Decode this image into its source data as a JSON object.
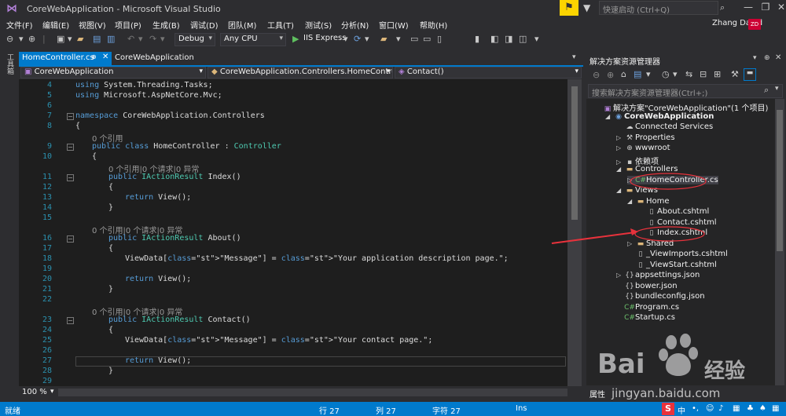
{
  "title": {
    "app": "CoreWebApplication - Microsoft Visual Studio",
    "quick_launch": "快速启动 (Ctrl+Q)"
  },
  "menu": {
    "items": [
      "文件(F)",
      "编辑(E)",
      "视图(V)",
      "项目(P)",
      "生成(B)",
      "调试(D)",
      "团队(M)",
      "工具(T)",
      "测试(S)",
      "分析(N)",
      "窗口(W)",
      "帮助(H)"
    ],
    "user": "Zhang David",
    "avatar": "ZD"
  },
  "toolbar": {
    "config": "Debug",
    "platform": "Any CPU",
    "run": "IIS Express"
  },
  "leftstrip": {
    "label": "工具箱"
  },
  "tabs": {
    "active": "HomeController.cs",
    "other": "CoreWebApplication"
  },
  "navbar": {
    "project": "CoreWebApplication",
    "class": "CoreWebApplication.Controllers.HomeControl",
    "member": "Contact()"
  },
  "code": {
    "lines": [
      {
        "n": "4",
        "t": "using System.Threading.Tasks;"
      },
      {
        "n": "5",
        "t": "using Microsoft.AspNetCore.Mvc;"
      },
      {
        "n": "6",
        "t": ""
      },
      {
        "n": "7",
        "t": "namespace CoreWebApplication.Controllers"
      },
      {
        "n": "8",
        "t": "{"
      },
      {
        "n": "",
        "t": "0 个引用"
      },
      {
        "n": "9",
        "t": "public class HomeController : Controller"
      },
      {
        "n": "10",
        "t": "{"
      },
      {
        "n": "",
        "t": "0 个引用|0 个请求|0 异常"
      },
      {
        "n": "11",
        "t": "public IActionResult Index()"
      },
      {
        "n": "12",
        "t": "{"
      },
      {
        "n": "13",
        "t": "return View();"
      },
      {
        "n": "14",
        "t": "}"
      },
      {
        "n": "15",
        "t": ""
      },
      {
        "n": "",
        "t": "0 个引用|0 个请求|0 异常"
      },
      {
        "n": "16",
        "t": "public IActionResult About()"
      },
      {
        "n": "17",
        "t": "{"
      },
      {
        "n": "18",
        "t": "ViewData[\"Message\"] = \"Your application description page.\";"
      },
      {
        "n": "19",
        "t": ""
      },
      {
        "n": "20",
        "t": "return View();"
      },
      {
        "n": "21",
        "t": "}"
      },
      {
        "n": "22",
        "t": ""
      },
      {
        "n": "",
        "t": "0 个引用|0 个请求|0 异常"
      },
      {
        "n": "23",
        "t": "public IActionResult Contact()"
      },
      {
        "n": "24",
        "t": "{"
      },
      {
        "n": "25",
        "t": "ViewData[\"Message\"] = \"Your contact page.\";"
      },
      {
        "n": "26",
        "t": ""
      },
      {
        "n": "27",
        "t": "return View();"
      },
      {
        "n": "28",
        "t": "}"
      },
      {
        "n": "29",
        "t": ""
      }
    ]
  },
  "zoom": "100 %",
  "solution": {
    "header": "解决方案资源管理器",
    "search_placeholder": "搜索解决方案资源管理器(Ctrl+;)",
    "items": [
      {
        "label": "解决方案\"CoreWebApplication\"(1 个项目)",
        "icon": "solution-icon"
      },
      {
        "label": "CoreWebApplication",
        "icon": "project-icon"
      },
      {
        "label": "Connected Services",
        "icon": "connected-services-icon"
      },
      {
        "label": "Properties",
        "icon": "wrench-icon"
      },
      {
        "label": "wwwroot",
        "icon": "globe-icon"
      },
      {
        "label": "依赖项",
        "icon": "dependencies-icon"
      },
      {
        "label": "Controllers",
        "icon": "folder-icon"
      },
      {
        "label": "HomeController.cs",
        "icon": "csharp-file-icon"
      },
      {
        "label": "Views",
        "icon": "folder-icon"
      },
      {
        "label": "Home",
        "icon": "folder-icon"
      },
      {
        "label": "About.cshtml",
        "icon": "file-icon"
      },
      {
        "label": "Contact.cshtml",
        "icon": "file-icon"
      },
      {
        "label": "Index.cshtml",
        "icon": "file-icon"
      },
      {
        "label": "Shared",
        "icon": "folder-icon"
      },
      {
        "label": "_ViewImports.cshtml",
        "icon": "file-icon"
      },
      {
        "label": "_ViewStart.cshtml",
        "icon": "file-icon"
      },
      {
        "label": "appsettings.json",
        "icon": "json-icon"
      },
      {
        "label": "bower.json",
        "icon": "json-icon"
      },
      {
        "label": "bundleconfig.json",
        "icon": "json-icon"
      },
      {
        "label": "Program.cs",
        "icon": "csharp-file-icon"
      },
      {
        "label": "Startup.cs",
        "icon": "csharp-file-icon"
      }
    ]
  },
  "properties": "属性",
  "status": {
    "ready": "就绪",
    "line": "行 27",
    "col": "列 27",
    "char": "字符 27",
    "mode": "Ins"
  },
  "watermark": {
    "brand": "Bai",
    "brand2": "经验",
    "url": "jingyan.baidu.com"
  },
  "colors": {
    "accent": "#007acc",
    "annotation": "#e8323c",
    "tab_active": "#007acc"
  }
}
